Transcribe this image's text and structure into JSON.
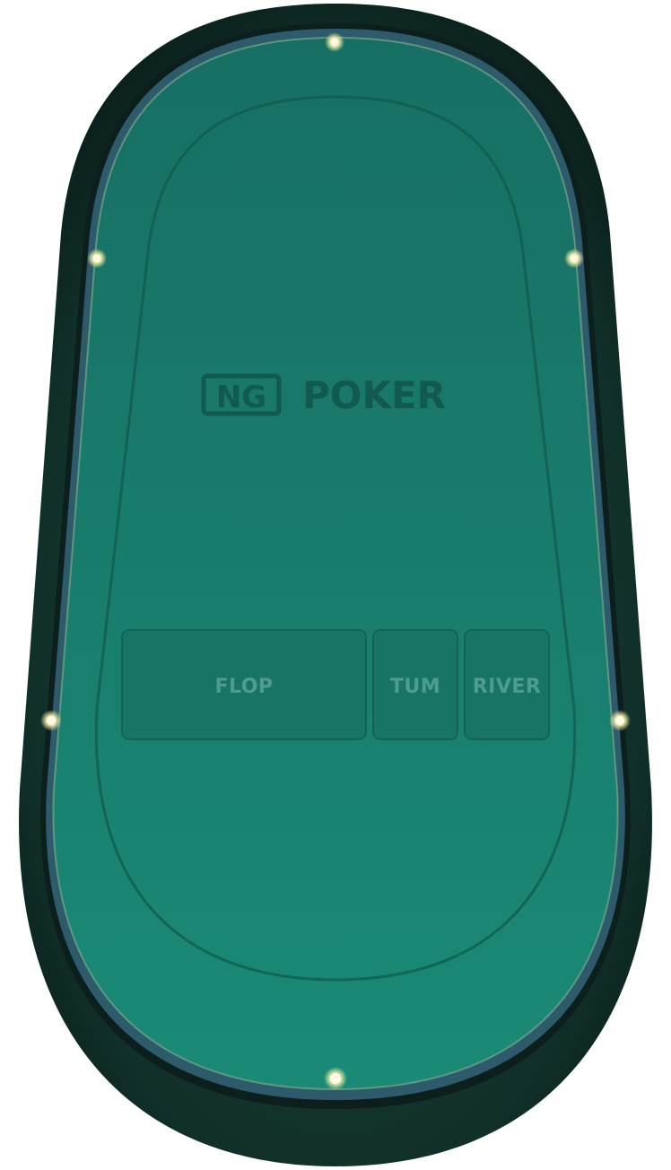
{
  "table": {
    "felt_color": "#1a7f6e",
    "felt_dark": "#16695d",
    "rail_color": "#0f2a26",
    "trim_color": "#2f5f6e",
    "light_color": "#fff7c8"
  },
  "logo": {
    "box_text": "NG",
    "word": "POKER"
  },
  "board": {
    "flop_label": "FLOP",
    "turn_label": "TUM",
    "river_label": "RIVER"
  }
}
